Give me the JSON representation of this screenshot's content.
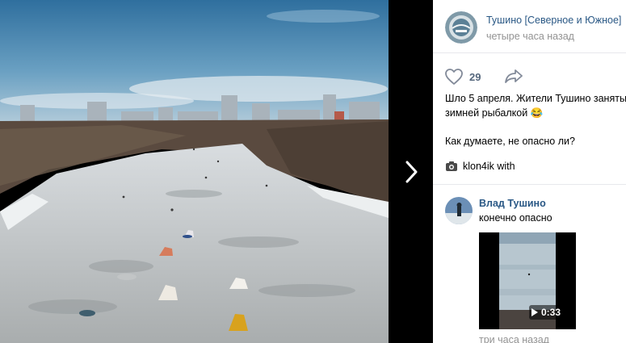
{
  "viewer": {
    "photo_alt": "",
    "next_icon": "chevron-right-icon"
  },
  "post": {
    "group_name": "Тушино [Северное и Южное]",
    "time": "четыре часа назад",
    "likes": "29",
    "text_line1": "Шло 5 апреля. Жители Тушино заняты",
    "text_line2": "зимней рыбалкой 😂",
    "text_line3": "Как думаете, не опасно ли?",
    "credit_icon": "camera-icon",
    "credit": "klon4ik with"
  },
  "comment": {
    "author": "Влад Тушино",
    "text": "конечно опасно",
    "video_duration": "0:33",
    "time": "три часа назад"
  },
  "colors": {
    "link": "#2a5885",
    "muted": "#939393",
    "icon": "#828a99"
  }
}
